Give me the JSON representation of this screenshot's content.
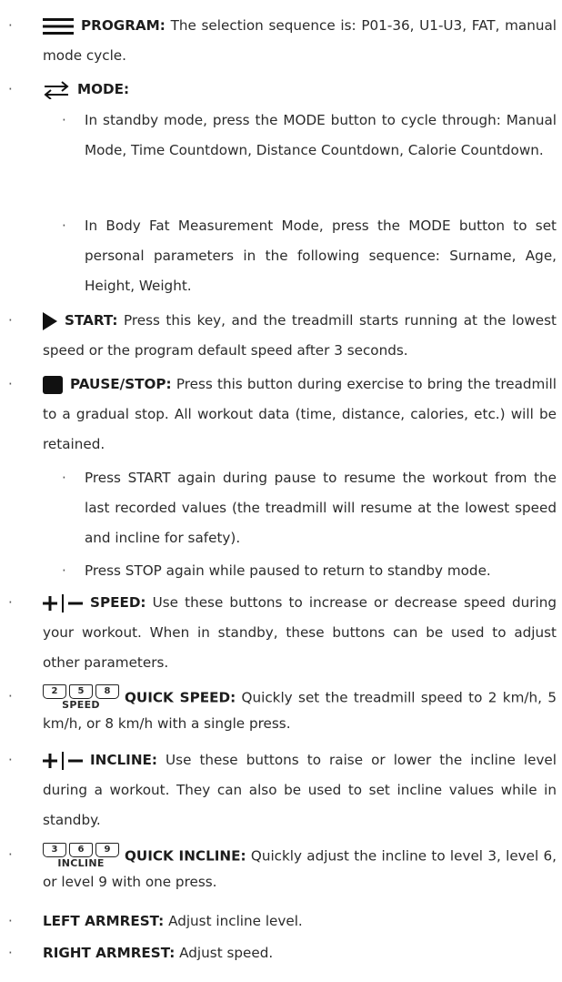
{
  "bullet_char": "·",
  "items": [
    {
      "label": "PROGRAM:",
      "text": "The selection sequence is: P01-36, U1-U3, FAT, manual mode cycle.",
      "icon": "menu-icon"
    },
    {
      "label": "MODE:",
      "icon": "swap-arrows-icon",
      "subitems": [
        "In standby mode, press the MODE button to cycle through: Manual Mode, Time Countdown, Distance Countdown, Calorie Countdown.",
        "In Body Fat Measurement Mode, press the MODE button to set personal parameters in the following sequence: Surname, Age, Height, Weight."
      ]
    },
    {
      "label": "START:",
      "text": "Press this key, and the treadmill starts running at the lowest speed or the program default speed after 3 seconds.",
      "icon": "play-icon"
    },
    {
      "label": "PAUSE/STOP:",
      "text": "Press this button during exercise to bring the treadmill to a gradual stop. All workout data (time, distance, calories, etc.) will be retained.",
      "icon": "stop-square-icon",
      "subitems": [
        "Press  START again during pause to resume the workout from the last recorded values (the treadmill will resume at the lowest speed and incline for safety).",
        "Press STOP again while paused to return to standby mode."
      ]
    },
    {
      "label": "SPEED:",
      "text": "Use these buttons to increase or decrease speed during your workout. When in standby, these buttons can be used to adjust other parameters.",
      "icon": "plus-minus-icon"
    },
    {
      "label": "QUICK SPEED:",
      "text": "Quickly set the treadmill speed to 2 km/h, 5 km/h, or 8 km/h with a single press.",
      "icon": "quick-speed-keys-icon",
      "keys": [
        "2",
        "5",
        "8"
      ],
      "key_caption": "SPEED"
    },
    {
      "label": "INCLINE:",
      "text": "Use these buttons to raise or lower the incline level during a workout. They can also be used to set incline values while in standby.",
      "icon": "plus-minus-icon"
    },
    {
      "label": "QUICK INCLINE:",
      "text": "Quickly adjust the incline to level 3, level 6, or level 9 with one press.",
      "icon": "quick-incline-keys-icon",
      "keys": [
        "3",
        "6",
        "9"
      ],
      "key_caption": "INCLINE"
    },
    {
      "label": "LEFT ARMREST:",
      "text": "Adjust incline level."
    },
    {
      "label": "RIGHT ARMREST:",
      "text": "Adjust speed."
    }
  ]
}
